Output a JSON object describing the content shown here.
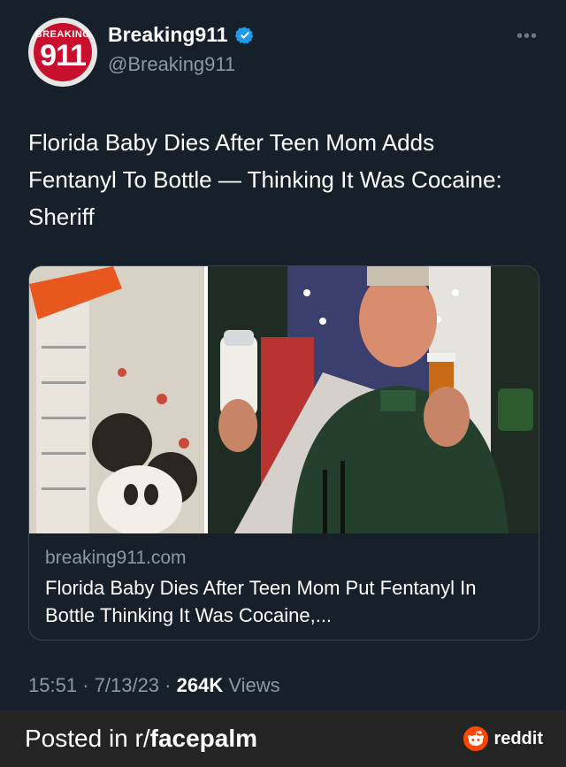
{
  "tweet": {
    "avatar": {
      "small_text": "BREAKING",
      "big_text": "911",
      "icon": "breaking911-logo"
    },
    "display_name": "Breaking911",
    "handle": "@Breaking911",
    "more_icon": "more-dots-icon",
    "verified_icon": "verified-badge-icon",
    "text": "Florida Baby Dies After Teen Mom Adds Fentanyl To Bottle — Thinking It Was Cocaine: Sheriff",
    "card": {
      "domain": "breaking911.com",
      "title": "Florida Baby Dies After Teen Mom Put Fentanyl In Bottle Thinking It Was Cocaine,..."
    },
    "meta": {
      "time": "15:51",
      "sep1": "·",
      "date": "7/13/23",
      "sep2": "·",
      "views_count": "264K",
      "views_label": "Views"
    }
  },
  "footer": {
    "posted_prefix": "Posted in r/",
    "subreddit": "facepalm",
    "brand": "reddit",
    "brand_icon": "reddit-snoo-icon"
  },
  "colors": {
    "background": "#15202b",
    "secondary_text": "#8b98a5",
    "verified": "#1d9bf0",
    "brand_red": "#c8102e",
    "reddit_orange": "#ff4500",
    "footer_bg": "#242424"
  }
}
